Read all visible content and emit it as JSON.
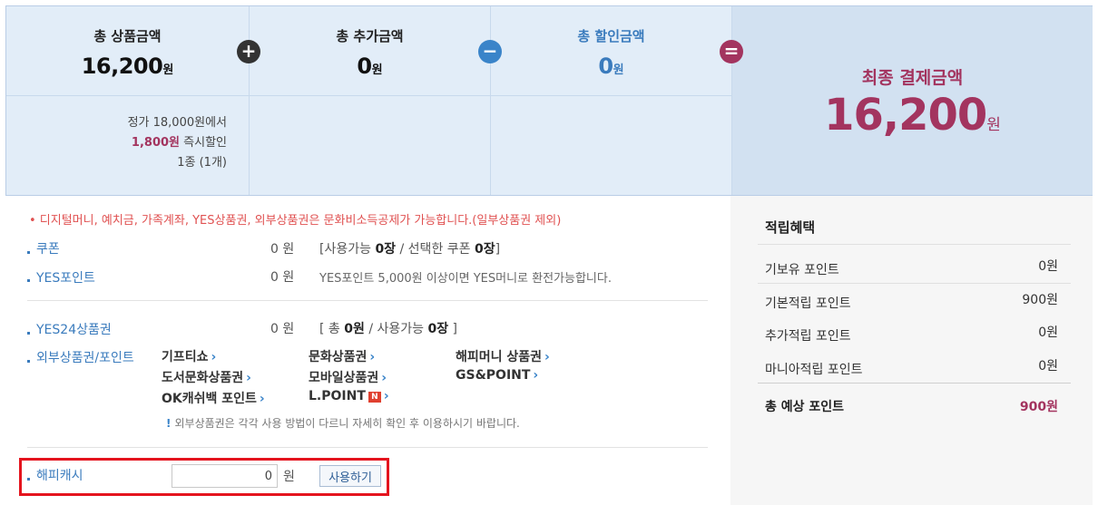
{
  "summary": {
    "product_total": {
      "label": "총 상품금액",
      "value": "16,200",
      "unit": "원"
    },
    "added_total": {
      "label": "총 추가금액",
      "value": "0",
      "unit": "원"
    },
    "discount_total": {
      "label": "총 할인금액",
      "value": "0",
      "unit": "원"
    },
    "operators": {
      "plus": "+",
      "minus": "−",
      "equals": "="
    },
    "detail": {
      "line1": "정가 18,000원에서",
      "discount_amount": "1,800원",
      "discount_text": "즉시할인",
      "count": "1종 (1개)"
    },
    "final": {
      "label": "최종 결제금액",
      "value": "16,200",
      "unit": "원"
    }
  },
  "notice": "• 디지털머니, 예치금, 가족계좌, YES상품권, 외부상품권은 문화비소득공제가 가능합니다.(일부상품권 제외)",
  "coupon": {
    "label": "쿠폰",
    "amount": "0 원",
    "info_prefix": "[사용가능 ",
    "available": "0장",
    "info_mid": " / 선택한 쿠폰 ",
    "selected": "0장",
    "info_suffix": "]"
  },
  "yes_point": {
    "label": "YES포인트",
    "amount": "0 원",
    "info": "YES포인트 5,000원 이상이면 YES머니로 환전가능합니다."
  },
  "yes24_gift": {
    "label": "YES24상품권",
    "amount": "0 원",
    "info_prefix": "[ 총 ",
    "total": "0원",
    "info_mid": " / 사용가능 ",
    "available": "0장",
    "info_suffix": " ]"
  },
  "external": {
    "label": "외부상품권/포인트",
    "items": [
      "기프티쇼",
      "문화상품권",
      "해피머니 상품권",
      "도서문화상품권",
      "모바일상품권",
      "GS&POINT",
      "OK캐쉬백 포인트",
      "L.POINT"
    ],
    "lpoint_badge": "N",
    "warning": "외부상품권은 각각 사용 방법이 다르니 자세히 확인 후 이용하시기 바랍니다.",
    "warning_mark": "!"
  },
  "happy_cash": {
    "label": "해피캐시",
    "value": "0",
    "unit": "원",
    "button": "사용하기"
  },
  "rewards": {
    "title": "적립혜택",
    "rows": [
      {
        "label": "기보유 포인트",
        "value": "0원"
      },
      {
        "label": "기본적립 포인트",
        "value": "900원"
      },
      {
        "label": "추가적립 포인트",
        "value": "0원"
      },
      {
        "label": "마니아적립 포인트",
        "value": "0원"
      }
    ],
    "total_label": "총 예상 포인트",
    "total_value": "900원"
  },
  "colors": {
    "accent_blue": "#3a7bbd",
    "accent_plum": "#a3345f",
    "notice_red": "#e05151",
    "highlight_red": "#e4141e"
  },
  "icons": {
    "chevron": "chevron-right-icon",
    "plus": "plus-circle-icon",
    "minus": "minus-circle-icon",
    "equals": "equals-circle-icon"
  }
}
